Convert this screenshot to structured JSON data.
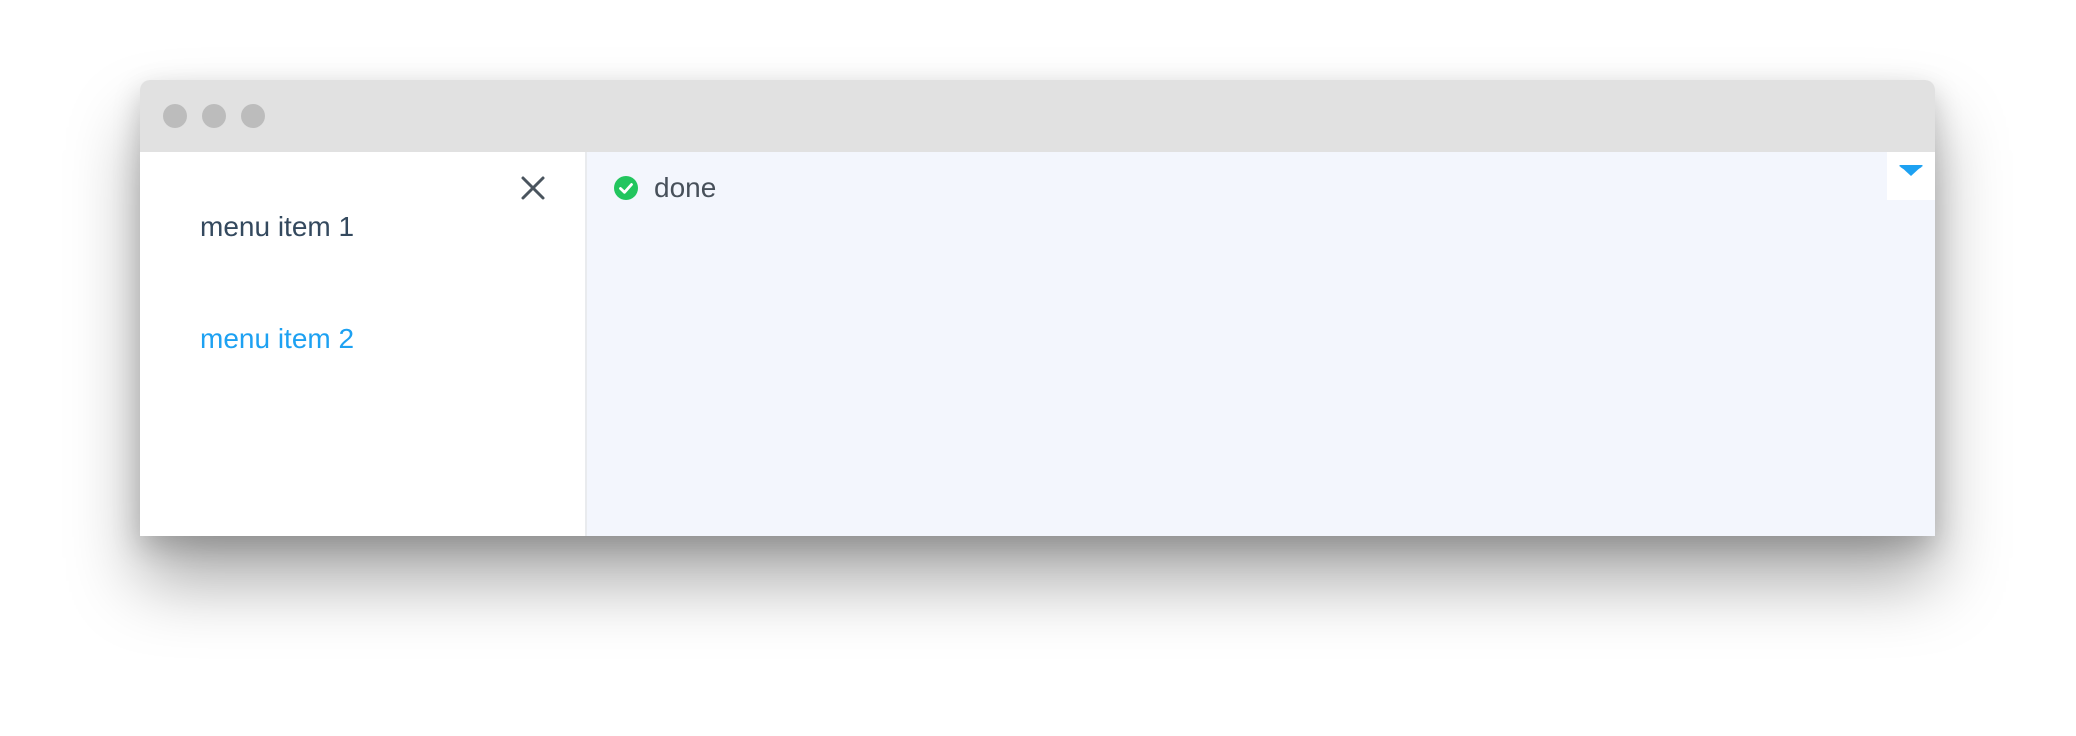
{
  "sidebar": {
    "close_icon": "close-icon",
    "items": [
      {
        "label": "menu item 1",
        "color": "#34495e"
      },
      {
        "label": "menu item 2",
        "color": "#1da1f2"
      }
    ]
  },
  "main": {
    "status": {
      "icon": "check-circle-icon",
      "icon_color": "#22c55e",
      "text": "done"
    },
    "toggle_icon": "caret-down-icon",
    "toggle_color": "#1da1f2",
    "background": "#f3f6fd"
  },
  "titlebar": {
    "background": "#e1e1e1",
    "buttons": [
      "window-close-dot",
      "window-minimize-dot",
      "window-maximize-dot"
    ]
  }
}
